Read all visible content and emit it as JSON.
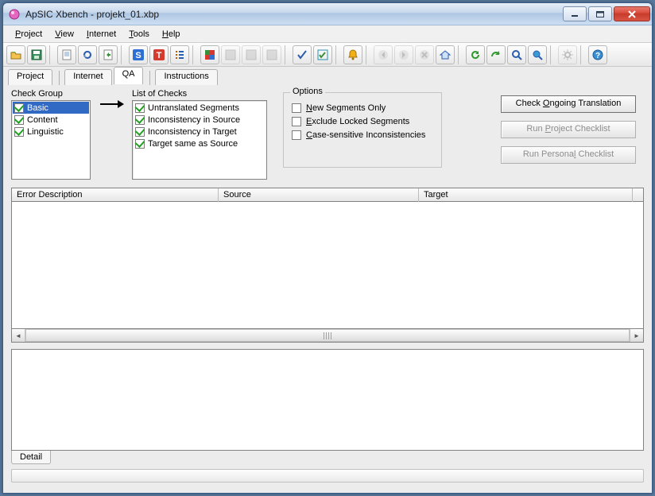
{
  "window": {
    "title": "ApSIC Xbench - projekt_01.xbp"
  },
  "menubar": {
    "items": [
      {
        "label": "Project",
        "accel": "P"
      },
      {
        "label": "View",
        "accel": "V"
      },
      {
        "label": "Internet",
        "accel": "I"
      },
      {
        "label": "Tools",
        "accel": "T"
      },
      {
        "label": "Help",
        "accel": "H"
      }
    ]
  },
  "tabs": {
    "items": [
      "Project",
      "Internet",
      "QA",
      "Instructions"
    ],
    "active": "QA"
  },
  "qa": {
    "check_group_label": "Check Group",
    "check_groups": [
      {
        "label": "Basic",
        "checked": true,
        "selected": true
      },
      {
        "label": "Content",
        "checked": true
      },
      {
        "label": "Linguistic",
        "checked": true
      }
    ],
    "list_of_checks_label": "List of Checks",
    "list_of_checks": [
      {
        "label": "Untranslated Segments",
        "checked": true
      },
      {
        "label": "Inconsistency in Source",
        "checked": true
      },
      {
        "label": "Inconsistency in Target",
        "checked": true
      },
      {
        "label": "Target same as Source",
        "checked": true
      }
    ],
    "options_label": "Options",
    "options": [
      {
        "label": "New Segments Only",
        "accel": "N"
      },
      {
        "label": "Exclude Locked Segments",
        "accel": "E"
      },
      {
        "label": "Case-sensitive Inconsistencies",
        "accel": "C"
      }
    ],
    "buttons": {
      "check_ongoing": {
        "label": "Check Ongoing Translation",
        "accel": "O",
        "enabled": true
      },
      "run_project": {
        "label": "Run Project Checklist",
        "accel": "P",
        "enabled": false
      },
      "run_personal": {
        "label": "Run Personal Checklist",
        "accel": "l",
        "enabled": false
      }
    }
  },
  "table": {
    "columns": [
      "Error Description",
      "Source",
      "Target"
    ]
  },
  "bottom": {
    "tab": "Detail"
  },
  "toolbar": {
    "icons": [
      "open-icon",
      "save-icon",
      "",
      "refresh-icon",
      "undo-icon",
      "stop-icon",
      "",
      "s-box-icon",
      "t-box-icon",
      "list-icon",
      "",
      "season-icon",
      "grid-icon",
      "grid2-icon",
      "grid3-icon",
      "",
      "check-icon",
      "checklist-icon",
      "",
      "bell-icon",
      "",
      "back-icon",
      "forward-icon",
      "cancel-icon",
      "home-icon",
      "",
      "reload-green-icon",
      "redo-green-icon",
      "zoom-icon",
      "zoom-world-icon",
      "",
      "gear-icon",
      "",
      "help-icon"
    ]
  }
}
